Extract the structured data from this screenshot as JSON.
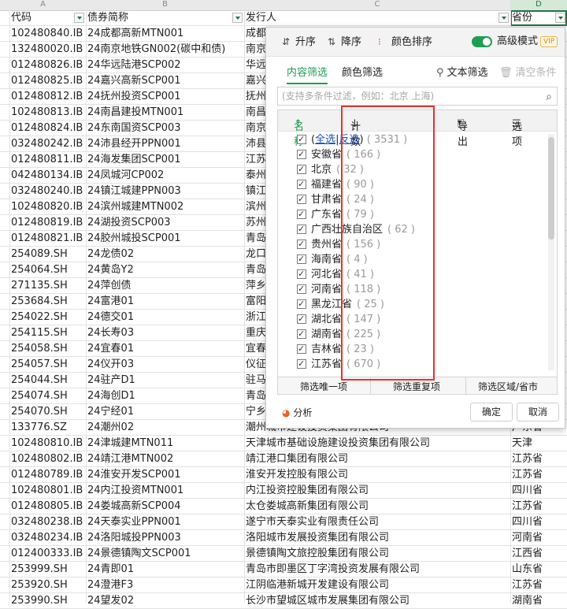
{
  "columns": {
    "a": "A",
    "b": "B",
    "c": "C",
    "d": "D"
  },
  "headers": {
    "code": "代码",
    "name": "债券简称",
    "issuer": "发行人",
    "province": "省份"
  },
  "rows": [
    {
      "code": "102480840.IB",
      "name": "24成都高新MTN001",
      "issuer": "成都",
      "province": ""
    },
    {
      "code": "132480020.IB",
      "name": "24南京地铁GN002(碳中和债)",
      "issuer": "南京",
      "province": ""
    },
    {
      "code": "012480826.IB",
      "name": "24华远陆港SCP002",
      "issuer": "华远",
      "province": ""
    },
    {
      "code": "012480825.IB",
      "name": "24嘉兴高新SCP001",
      "issuer": "嘉兴",
      "province": ""
    },
    {
      "code": "012480812.IB",
      "name": "24抚州投资SCP001",
      "issuer": "抚州",
      "province": ""
    },
    {
      "code": "102480813.IB",
      "name": "24南昌建投MTN001",
      "issuer": "南昌",
      "province": ""
    },
    {
      "code": "012480824.IB",
      "name": "24东南国资SCP003",
      "issuer": "南京",
      "province": ""
    },
    {
      "code": "032480242.IB",
      "name": "24沛县经开PPN001",
      "issuer": "沛县",
      "province": ""
    },
    {
      "code": "012480811.IB",
      "name": "24海发集团SCP001",
      "issuer": "江苏",
      "province": ""
    },
    {
      "code": "042480134.IB",
      "name": "24凤城河CP002",
      "issuer": "泰州",
      "province": ""
    },
    {
      "code": "032480240.IB",
      "name": "24镇江城建PPN003",
      "issuer": "镇江",
      "province": ""
    },
    {
      "code": "102480820.IB",
      "name": "24滨州城建MTN002",
      "issuer": "滨州",
      "province": ""
    },
    {
      "code": "012480819.IB",
      "name": "24湖投资SCP003",
      "issuer": "苏州",
      "province": ""
    },
    {
      "code": "012480821.IB",
      "name": "24胶州城投SCP001",
      "issuer": "青岛",
      "province": ""
    },
    {
      "code": "254089.SH",
      "name": "24龙债02",
      "issuer": "龙口",
      "province": ""
    },
    {
      "code": "254064.SH",
      "name": "24黄岛Y2",
      "issuer": "青岛",
      "province": ""
    },
    {
      "code": "271135.SH",
      "name": "24萍创债",
      "issuer": "萍乡",
      "province": ""
    },
    {
      "code": "253684.SH",
      "name": "24富港01",
      "issuer": "富阳",
      "province": ""
    },
    {
      "code": "254022.SH",
      "name": "24德交01",
      "issuer": "浙江",
      "province": ""
    },
    {
      "code": "254115.SH",
      "name": "24长寿03",
      "issuer": "重庆",
      "province": ""
    },
    {
      "code": "254058.SH",
      "name": "24宜春01",
      "issuer": "宜春",
      "province": ""
    },
    {
      "code": "254057.SH",
      "name": "24仪开03",
      "issuer": "仪征",
      "province": ""
    },
    {
      "code": "254044.SH",
      "name": "24驻产D1",
      "issuer": "驻马",
      "province": ""
    },
    {
      "code": "254074.SH",
      "name": "24海创D1",
      "issuer": "青岛",
      "province": ""
    },
    {
      "code": "254070.SH",
      "name": "24宁经01",
      "issuer": "宁乡",
      "province": ""
    },
    {
      "code": "133776.SZ",
      "name": "24潮州02",
      "issuer": "潮州城市建设投资集团有限公司",
      "province": "广东省"
    },
    {
      "code": "102480810.IB",
      "name": "24津城建MTN011",
      "issuer": "天津城市基础设施建设投资集团有限公司",
      "province": "天津"
    },
    {
      "code": "102480802.IB",
      "name": "24靖江港MTN002",
      "issuer": "靖江港口集团有限公司",
      "province": "江苏省"
    },
    {
      "code": "012480789.IB",
      "name": "24淮安开发SCP001",
      "issuer": "淮安开发控股有限公司",
      "province": "江苏省"
    },
    {
      "code": "102480801.IB",
      "name": "24内江投资MTN001",
      "issuer": "内江投资控股集团有限公司",
      "province": "四川省"
    },
    {
      "code": "012480805.IB",
      "name": "24娄城高新SCP004",
      "issuer": "太仓娄城高新集团有限公司",
      "province": "江苏省"
    },
    {
      "code": "032480238.IB",
      "name": "24天泰实业PPN001",
      "issuer": "遂宁市天泰实业有限责任公司",
      "province": "四川省"
    },
    {
      "code": "032480234.IB",
      "name": "24洛阳城投PPN003",
      "issuer": "洛阳城市发展投资集团有限公司",
      "province": "河南省"
    },
    {
      "code": "012400333.IB",
      "name": "24景德镇陶文SCP001",
      "issuer": "景德镇陶文旅控股集团有限公司",
      "province": "江西省"
    },
    {
      "code": "253999.SH",
      "name": "24青即01",
      "issuer": "青岛市即墨区丁字湾投资发展有限公司",
      "province": "山东省"
    },
    {
      "code": "253920.SH",
      "name": "24澄港F3",
      "issuer": "江阴临港新城开发建设有限公司",
      "province": "江苏省"
    },
    {
      "code": "253990.SH",
      "name": "24望发02",
      "issuer": "长沙市望城区城市发展集团有限公司",
      "province": "湖南省"
    }
  ],
  "panel": {
    "sort_asc": "升序",
    "sort_desc": "降序",
    "sort_color": "颜色排序",
    "advanced_mode": "高级模式",
    "vip": "VIP",
    "tab_content": "内容筛选",
    "tab_color": "颜色筛选",
    "text_filter": "文本筛选",
    "clear_filter": "清空条件",
    "search_placeholder": "(支持多条件过滤，例如：北京 上海)",
    "col_name": "名称",
    "col_count": "计数",
    "export": "导出",
    "options": "选项",
    "select_all": "全选",
    "invert": "反选",
    "total": "( 3531 )",
    "items": [
      {
        "name": "安徽省",
        "count": "( 166 )"
      },
      {
        "name": "北京",
        "count": "( 32 )"
      },
      {
        "name": "福建省",
        "count": "( 90 )"
      },
      {
        "name": "甘肃省",
        "count": "( 24 )"
      },
      {
        "name": "广东省",
        "count": "( 79 )"
      },
      {
        "name": "广西壮族自治区",
        "count": "( 62 )"
      },
      {
        "name": "贵州省",
        "count": "( 156 )"
      },
      {
        "name": "海南省",
        "count": "( 4 )"
      },
      {
        "name": "河北省",
        "count": "( 41 )"
      },
      {
        "name": "河南省",
        "count": "( 118 )"
      },
      {
        "name": "黑龙江省",
        "count": "( 25 )"
      },
      {
        "name": "湖北省",
        "count": "( 147 )"
      },
      {
        "name": "湖南省",
        "count": "( 225 )"
      },
      {
        "name": "吉林省",
        "count": "( 23 )"
      },
      {
        "name": "江苏省",
        "count": "( 670 )"
      }
    ],
    "filter_unique": "筛选唯一项",
    "filter_dup": "筛选重复项",
    "filter_region": "筛选区域/省市",
    "analyze": "分析",
    "ok": "确定",
    "cancel": "取消"
  }
}
